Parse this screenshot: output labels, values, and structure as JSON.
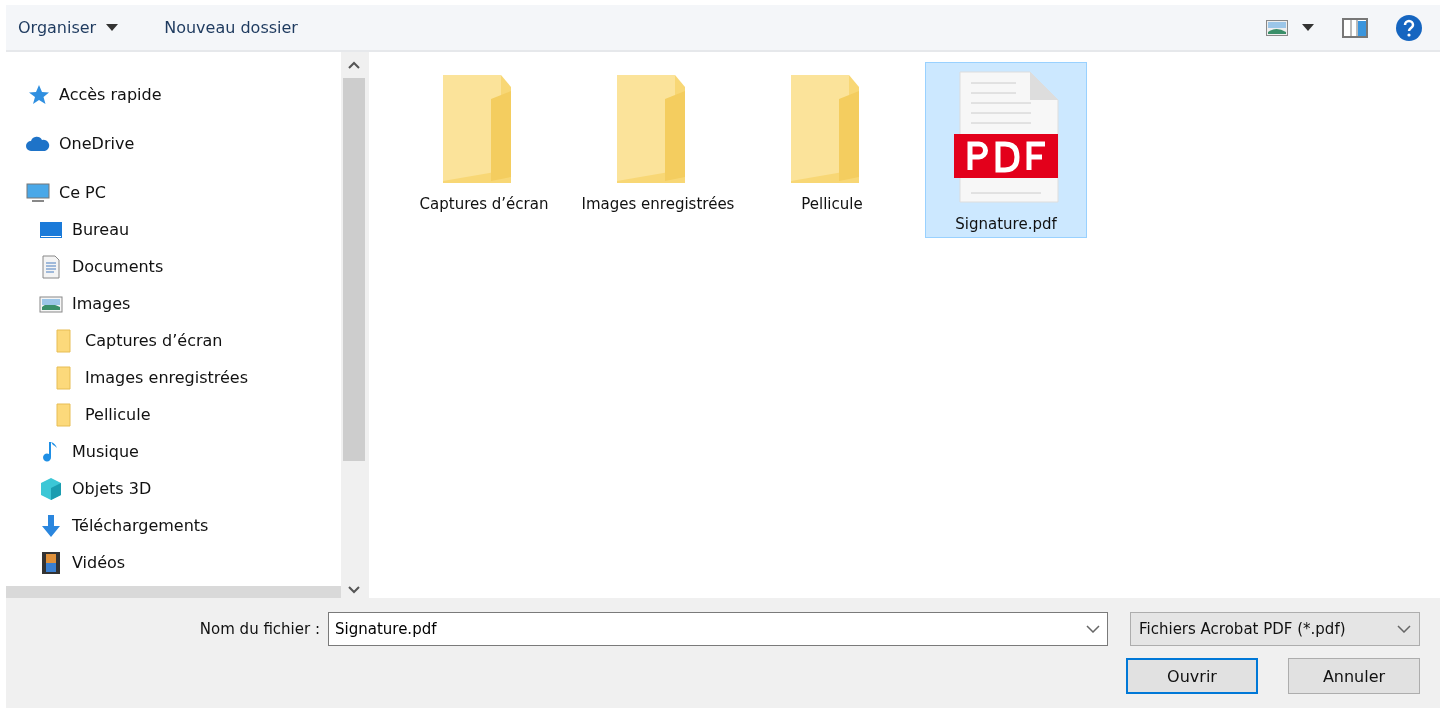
{
  "toolbar": {
    "organize": "Organiser",
    "new_folder": "Nouveau dossier"
  },
  "nav": [
    {
      "label": "Accès rapide",
      "kind": "star"
    },
    {
      "label": "OneDrive",
      "kind": "cloud"
    },
    {
      "label": "Ce PC",
      "kind": "pc",
      "children": [
        {
          "label": "Bureau",
          "kind": "desktop"
        },
        {
          "label": "Documents",
          "kind": "document"
        },
        {
          "label": "Images",
          "kind": "images",
          "children": [
            {
              "label": "Captures d’écran",
              "kind": "folder"
            },
            {
              "label": "Images enregistrées",
              "kind": "folder"
            },
            {
              "label": "Pellicule",
              "kind": "folder"
            }
          ]
        },
        {
          "label": "Musique",
          "kind": "music"
        },
        {
          "label": "Objets 3D",
          "kind": "cube"
        },
        {
          "label": "Téléchargements",
          "kind": "download"
        },
        {
          "label": "Vidéos",
          "kind": "video"
        }
      ]
    }
  ],
  "files": [
    {
      "name": "Captures d’écran",
      "kind": "folder",
      "selected": false
    },
    {
      "name": "Images enregistrées",
      "kind": "folder",
      "selected": false
    },
    {
      "name": "Pellicule",
      "kind": "folder",
      "selected": false
    },
    {
      "name": "Signature.pdf",
      "kind": "pdf",
      "selected": true
    }
  ],
  "filename": {
    "label": "Nom du fichier :",
    "value": "Signature.pdf"
  },
  "filter": "Fichiers Acrobat PDF (*.pdf)",
  "buttons": [
    {
      "label": "Ouvrir",
      "default": true
    },
    {
      "label": "Annuler",
      "default": false
    }
  ]
}
